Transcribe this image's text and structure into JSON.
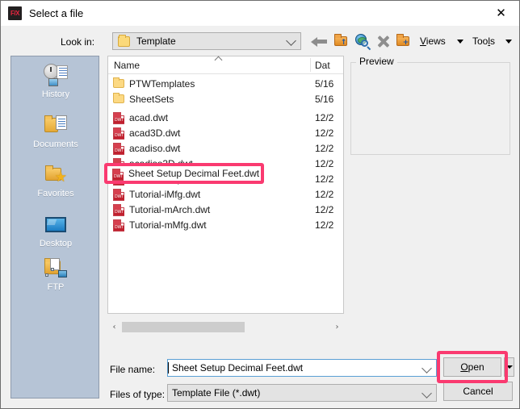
{
  "window": {
    "title": "Select a file",
    "app_icon": "F/X",
    "close_label": "✕"
  },
  "toolbar": {
    "lookin_label": "Look in:",
    "lookin_value": "Template",
    "buttons": [
      {
        "name": "back-icon",
        "tip": "Back"
      },
      {
        "name": "up-one-level-icon",
        "tip": "Up one level"
      },
      {
        "name": "search-web-icon",
        "tip": "Search the Web"
      },
      {
        "name": "delete-icon",
        "tip": "Delete"
      },
      {
        "name": "new-folder-icon",
        "tip": "Create New Folder"
      }
    ],
    "views_label": "Views",
    "views_mnemonic": "V",
    "tools_label": "Tools",
    "tools_mnemonic": "l"
  },
  "places": [
    {
      "label": "History",
      "icon": "history-icon"
    },
    {
      "label": "Documents",
      "icon": "documents-icon"
    },
    {
      "label": "Favorites",
      "icon": "favorites-icon"
    },
    {
      "label": "Desktop",
      "icon": "desktop-icon"
    },
    {
      "label": "FTP",
      "icon": "ftp-icon"
    }
  ],
  "filelist": {
    "columns": [
      "Name",
      "Dat"
    ],
    "sort": "ascending",
    "rows": [
      {
        "name": "PTWTemplates",
        "date": "5/16",
        "type": "folder"
      },
      {
        "name": "SheetSets",
        "date": "5/16",
        "type": "folder"
      },
      {
        "name": "acad.dwt",
        "date": "12/2",
        "type": "dwt"
      },
      {
        "name": "acad3D.dwt",
        "date": "12/2",
        "type": "dwt"
      },
      {
        "name": "acadiso.dwt",
        "date": "12/2",
        "type": "dwt"
      },
      {
        "name": "acadiso3D.dwt",
        "date": "12/2",
        "type": "dwt"
      },
      {
        "name": "Sheet Setup Decimal Feet.dwt",
        "date": "12/2",
        "type": "dwt"
      },
      {
        "name": "Tutorial-iMfg.dwt",
        "date": "12/2",
        "type": "dwt"
      },
      {
        "name": "Tutorial-mArch.dwt",
        "date": "12/2",
        "type": "dwt"
      },
      {
        "name": "Tutorial-mMfg.dwt",
        "date": "12/2",
        "type": "dwt"
      }
    ],
    "scroll_left_icon": "‹",
    "scroll_right_icon": "›"
  },
  "preview": {
    "label": "Preview",
    "content": ""
  },
  "form": {
    "filename_label": "File name:",
    "filename_value": "Sheet Setup Decimal Feet.dwt",
    "filetype_label": "Files of type:",
    "filetype_value": "Template File (*.dwt)"
  },
  "buttons": {
    "open_label": "Open",
    "open_mnemonic": "O",
    "open_rest": "pen",
    "cancel_label": "Cancel"
  },
  "annotations": {
    "highlight_color": "#fa3a70",
    "highlighted_file": "Sheet Setup Decimal Feet.dwt",
    "highlighted_button": "Open"
  }
}
